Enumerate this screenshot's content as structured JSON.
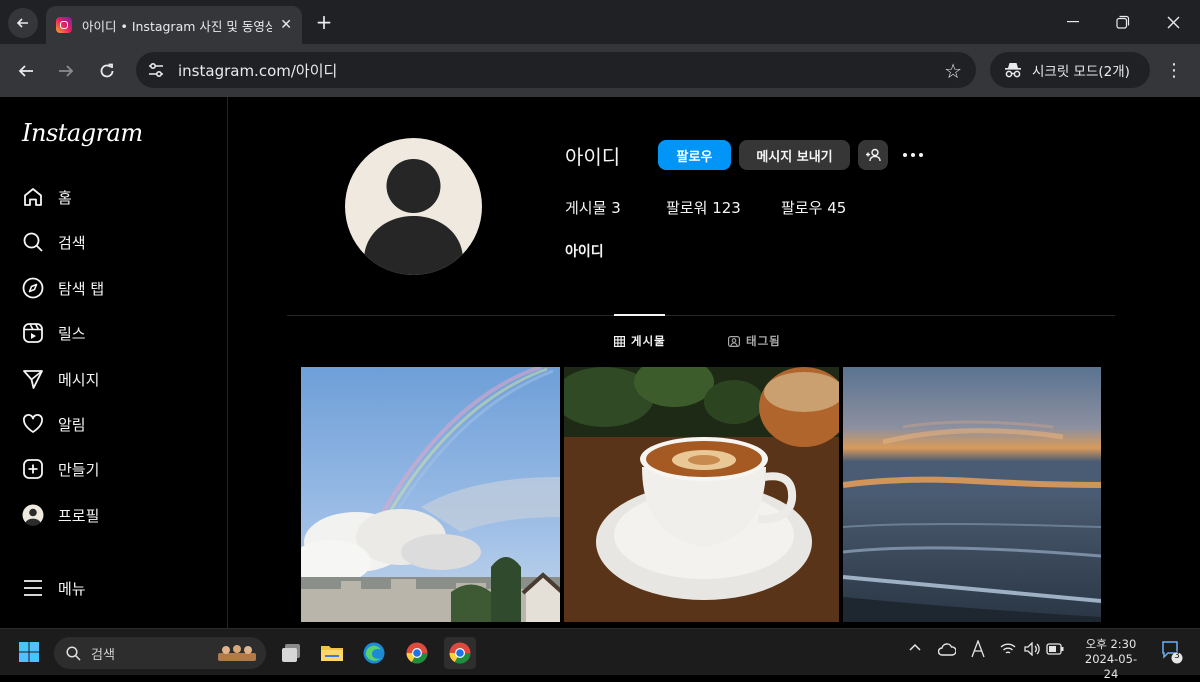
{
  "browser": {
    "tab_title": "아이디 • Instagram 사진 및 동영상",
    "url": "instagram.com/아이디",
    "incognito_label": "시크릿 모드(2개)"
  },
  "sidebar": {
    "logo": "Instagram",
    "items": [
      {
        "label": "홈",
        "icon": "home-icon"
      },
      {
        "label": "검색",
        "icon": "search-icon"
      },
      {
        "label": "탐색 탭",
        "icon": "compass-icon"
      },
      {
        "label": "릴스",
        "icon": "reels-icon"
      },
      {
        "label": "메시지",
        "icon": "send-icon"
      },
      {
        "label": "알림",
        "icon": "heart-icon"
      },
      {
        "label": "만들기",
        "icon": "plus-square-icon"
      },
      {
        "label": "프로필",
        "icon": "avatar-icon"
      }
    ],
    "menu_label": "메뉴"
  },
  "profile": {
    "username": "아이디",
    "follow_button": "팔로우",
    "message_button": "메시지 보내기",
    "posts_label": "게시물",
    "posts_count": "3",
    "followers_label": "팔로워",
    "followers_count": "123",
    "following_label": "팔로우",
    "following_count": "45",
    "full_name": "아이디"
  },
  "profile_tabs": [
    {
      "label": "게시물",
      "active": true
    },
    {
      "label": "태그됨",
      "active": false
    }
  ],
  "posts": [
    {
      "subject": "rainbow sky"
    },
    {
      "subject": "latte coffee cup"
    },
    {
      "subject": "sunset over sea"
    }
  ],
  "taskbar": {
    "search_placeholder": "검색",
    "time": "오후 2:30",
    "date": "2024-05-24",
    "notification_count": "3"
  },
  "colors": {
    "accent": "#0095f6",
    "background": "#000000",
    "secondary_button": "#363636"
  }
}
